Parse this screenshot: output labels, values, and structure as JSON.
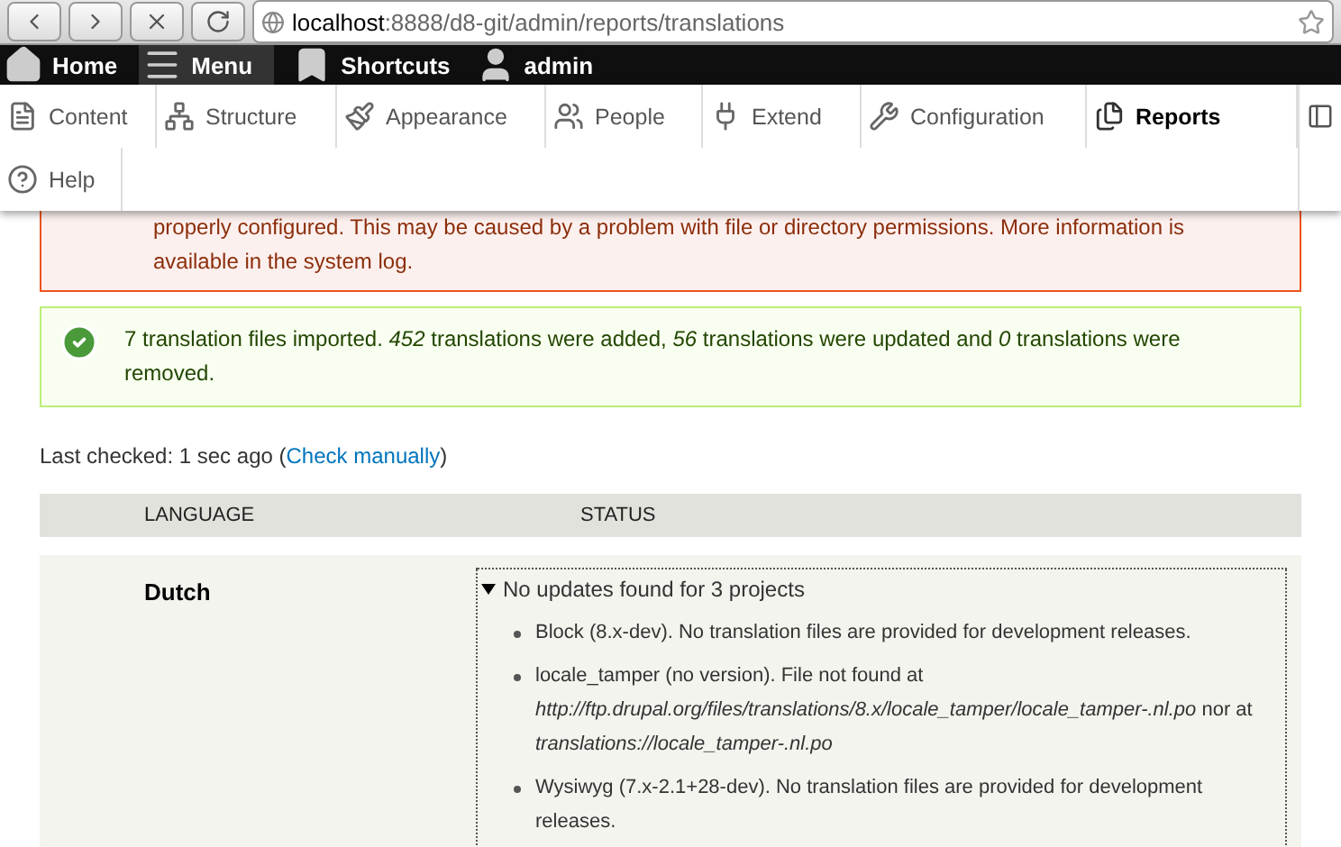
{
  "browser": {
    "url_host": "localhost",
    "url_rest": ":8888/d8-git/admin/reports/translations"
  },
  "toolbar": {
    "items": [
      {
        "kind": "home",
        "label": "Home",
        "selected": false
      },
      {
        "kind": "menu",
        "label": "Menu",
        "selected": true
      },
      {
        "kind": "shortcuts",
        "label": "Shortcuts",
        "selected": false
      },
      {
        "kind": "user",
        "label": "admin",
        "selected": false
      }
    ]
  },
  "tray": {
    "items": [
      {
        "kind": "content",
        "label": "Content",
        "selected": false
      },
      {
        "kind": "structure",
        "label": "Structure",
        "selected": false
      },
      {
        "kind": "appearance",
        "label": "Appearance",
        "selected": false
      },
      {
        "kind": "people",
        "label": "People",
        "selected": false
      },
      {
        "kind": "extend",
        "label": "Extend",
        "selected": false
      },
      {
        "kind": "configuration",
        "label": "Configuration",
        "selected": false
      },
      {
        "kind": "reports",
        "label": "Reports",
        "selected": true
      },
      {
        "kind": "help",
        "label": "Help",
        "selected": false
      }
    ]
  },
  "messages": [
    {
      "kind": "error",
      "text": "properly configured. This may be caused by a problem with file or directory permissions. More information is available in the system log."
    },
    {
      "kind": "status",
      "text": "7 translation files imported. *452* translations were added, *56* translations were updated and *0* translations were removed."
    }
  ],
  "last_checked": {
    "text": "Last checked: 1 sec ago (",
    "link": "Check manually",
    "suffix": ")"
  },
  "table": {
    "columns": [
      "LANGUAGE",
      "STATUS"
    ],
    "rows": [
      {
        "language": "Dutch",
        "summary": "No updates found for 3 projects",
        "expanded": true,
        "details": [
          "Block (8.x-dev). No translation files are provided for development releases.",
          "locale_tamper (no version). File not found at *http://ftp.drupal.org/files/translations/8.x/locale_tamper/locale_tamper-.nl.po* nor at *translations://locale_tamper-.nl.po*",
          "Wysiwyg (7.x-2.1+28-dev). No translation files are provided for development releases."
        ]
      }
    ]
  }
}
